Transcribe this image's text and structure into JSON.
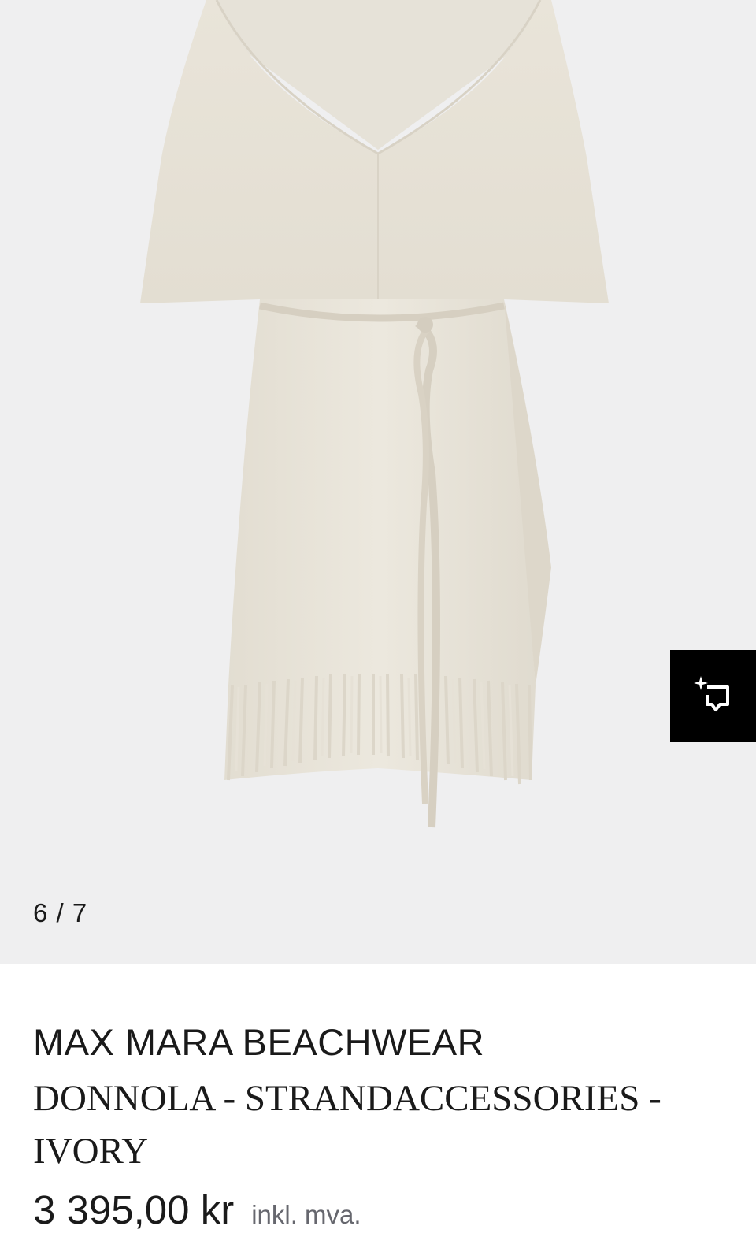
{
  "gallery": {
    "counter": "6 / 7",
    "image_alt": "Ivory knit fringed beach cover-up with belt",
    "similar_icon": "sparkle-crop-icon"
  },
  "product": {
    "brand": "MAX MARA BEACHWEAR",
    "name": "DONNOLA - STRANDACCESSORIES - IVORY",
    "price": "3 395,00 kr",
    "tax_note": "inkl. mva."
  },
  "colors": {
    "gallery_bg": "#efeff0",
    "garment": "#e8e3d8",
    "button_bg": "#000000",
    "text": "#1a1a1a",
    "muted": "#66676e"
  }
}
